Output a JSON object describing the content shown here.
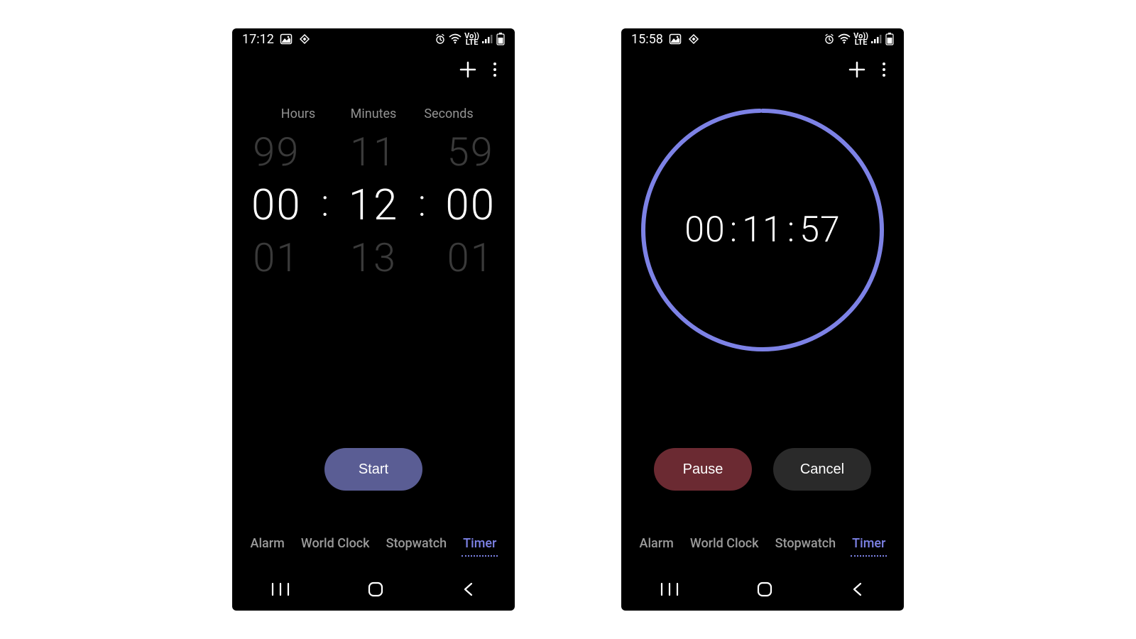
{
  "left": {
    "status": {
      "time": "17:12"
    },
    "picker": {
      "labels": {
        "hours": "Hours",
        "minutes": "Minutes",
        "seconds": "Seconds"
      },
      "prev": {
        "h": "99",
        "m": "11",
        "s": "59"
      },
      "active": {
        "h": "00",
        "m": "12",
        "s": "00"
      },
      "next": {
        "h": "01",
        "m": "13",
        "s": "01"
      },
      "sep": ":"
    },
    "buttons": {
      "start": "Start"
    },
    "tabs": {
      "alarm": "Alarm",
      "world_clock": "World Clock",
      "stopwatch": "Stopwatch",
      "timer": "Timer"
    }
  },
  "right": {
    "status": {
      "time": "15:58"
    },
    "running": {
      "h": "00",
      "m": "11",
      "s": "57",
      "sep": ":",
      "ring_color": "#7d82e6",
      "progress": 0.996
    },
    "buttons": {
      "pause": "Pause",
      "cancel": "Cancel"
    },
    "tabs": {
      "alarm": "Alarm",
      "world_clock": "World Clock",
      "stopwatch": "Stopwatch",
      "timer": "Timer"
    }
  },
  "status_volte": {
    "line1": "Vo))",
    "line2": "LTE"
  }
}
